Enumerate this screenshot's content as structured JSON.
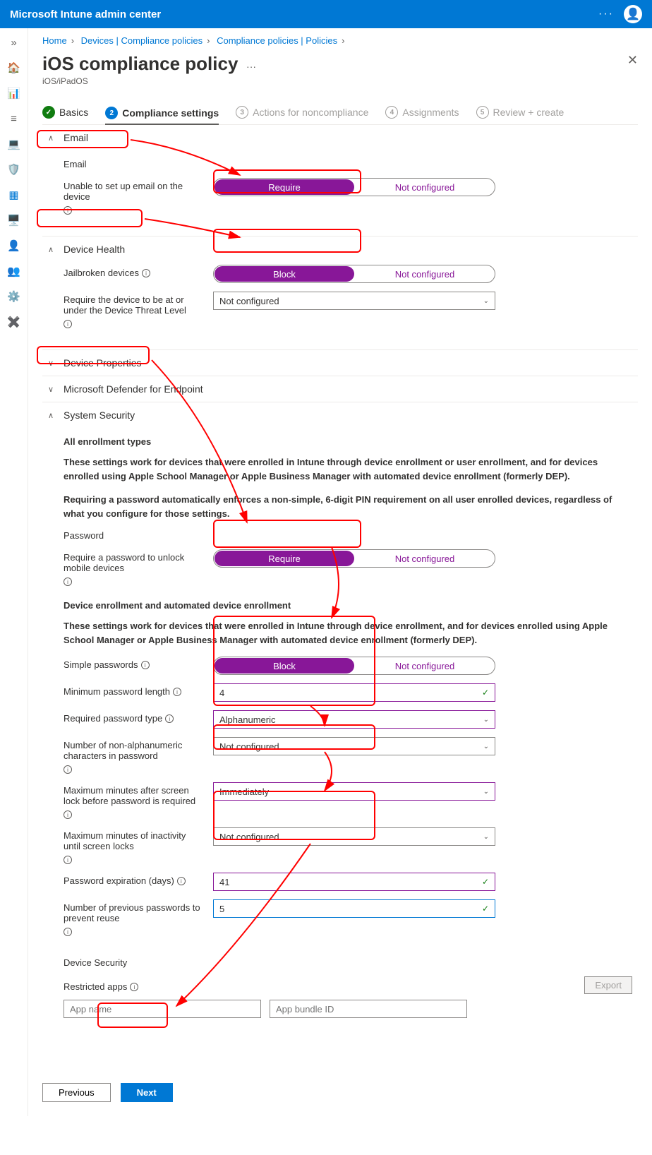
{
  "header": {
    "title": "Microsoft Intune admin center"
  },
  "breadcrumb": {
    "home": "Home",
    "devices": "Devices | Compliance policies",
    "policies": "Compliance policies | Policies"
  },
  "page": {
    "title": "iOS compliance policy",
    "subtitle": "iOS/iPadOS"
  },
  "tabs": {
    "basics": "Basics",
    "compliance": "Compliance settings",
    "actions": "Actions for noncompliance",
    "assignments": "Assignments",
    "review": "Review + create"
  },
  "sections": {
    "email": {
      "title": "Email",
      "subhead": "Email",
      "row1_label": "Unable to set up email on the device",
      "row1_left": "Require",
      "row1_right": "Not configured"
    },
    "deviceHealth": {
      "title": "Device Health",
      "row1_label": "Jailbroken devices",
      "row1_left": "Block",
      "row1_right": "Not configured",
      "row2_label": "Require the device to be at or under the Device Threat Level",
      "row2_value": "Not configured"
    },
    "deviceProps": {
      "title": "Device Properties"
    },
    "defender": {
      "title": "Microsoft Defender for Endpoint"
    },
    "security": {
      "title": "System Security",
      "h1": "All enrollment types",
      "p1": "These settings work for devices that were enrolled in Intune through device enrollment or user enrollment, and for devices enrolled using Apple School Manager or Apple Business Manager with automated device enrollment (formerly DEP).",
      "p2": "Requiring a password automatically enforces a non-simple, 6-digit PIN requirement on all user enrolled devices, regardless of what you configure for those settings.",
      "pw_head": "Password",
      "row_require_label": "Require a password to unlock mobile devices",
      "row_require_left": "Require",
      "row_require_right": "Not configured",
      "h2": "Device enrollment and automated device enrollment",
      "p3": "These settings work for devices that were enrolled in Intune through device enrollment, and for devices enrolled using Apple School Manager or Apple Business Manager with automated device enrollment (formerly DEP).",
      "row_simple_label": "Simple passwords",
      "row_simple_left": "Block",
      "row_simple_right": "Not configured",
      "row_min_label": "Minimum password length",
      "row_min_value": "4",
      "row_type_label": "Required password type",
      "row_type_value": "Alphanumeric",
      "row_nonalpha_label": "Number of non-alphanumeric characters in password",
      "row_nonalpha_value": "Not configured",
      "row_maxlock_label": "Maximum minutes after screen lock before password is required",
      "row_maxlock_value": "Immediately",
      "row_maxinact_label": "Maximum minutes of inactivity until screen locks",
      "row_maxinact_value": "Not configured",
      "row_exp_label": "Password expiration (days)",
      "row_exp_value": "41",
      "row_prev_label": "Number of previous passwords to prevent reuse",
      "row_prev_value": "5",
      "devsec_head": "Device Security",
      "row_apps_label": "Restricted apps",
      "export": "Export",
      "app_name_ph": "App name",
      "bundle_ph": "App bundle ID"
    }
  },
  "footer": {
    "prev": "Previous",
    "next": "Next"
  }
}
